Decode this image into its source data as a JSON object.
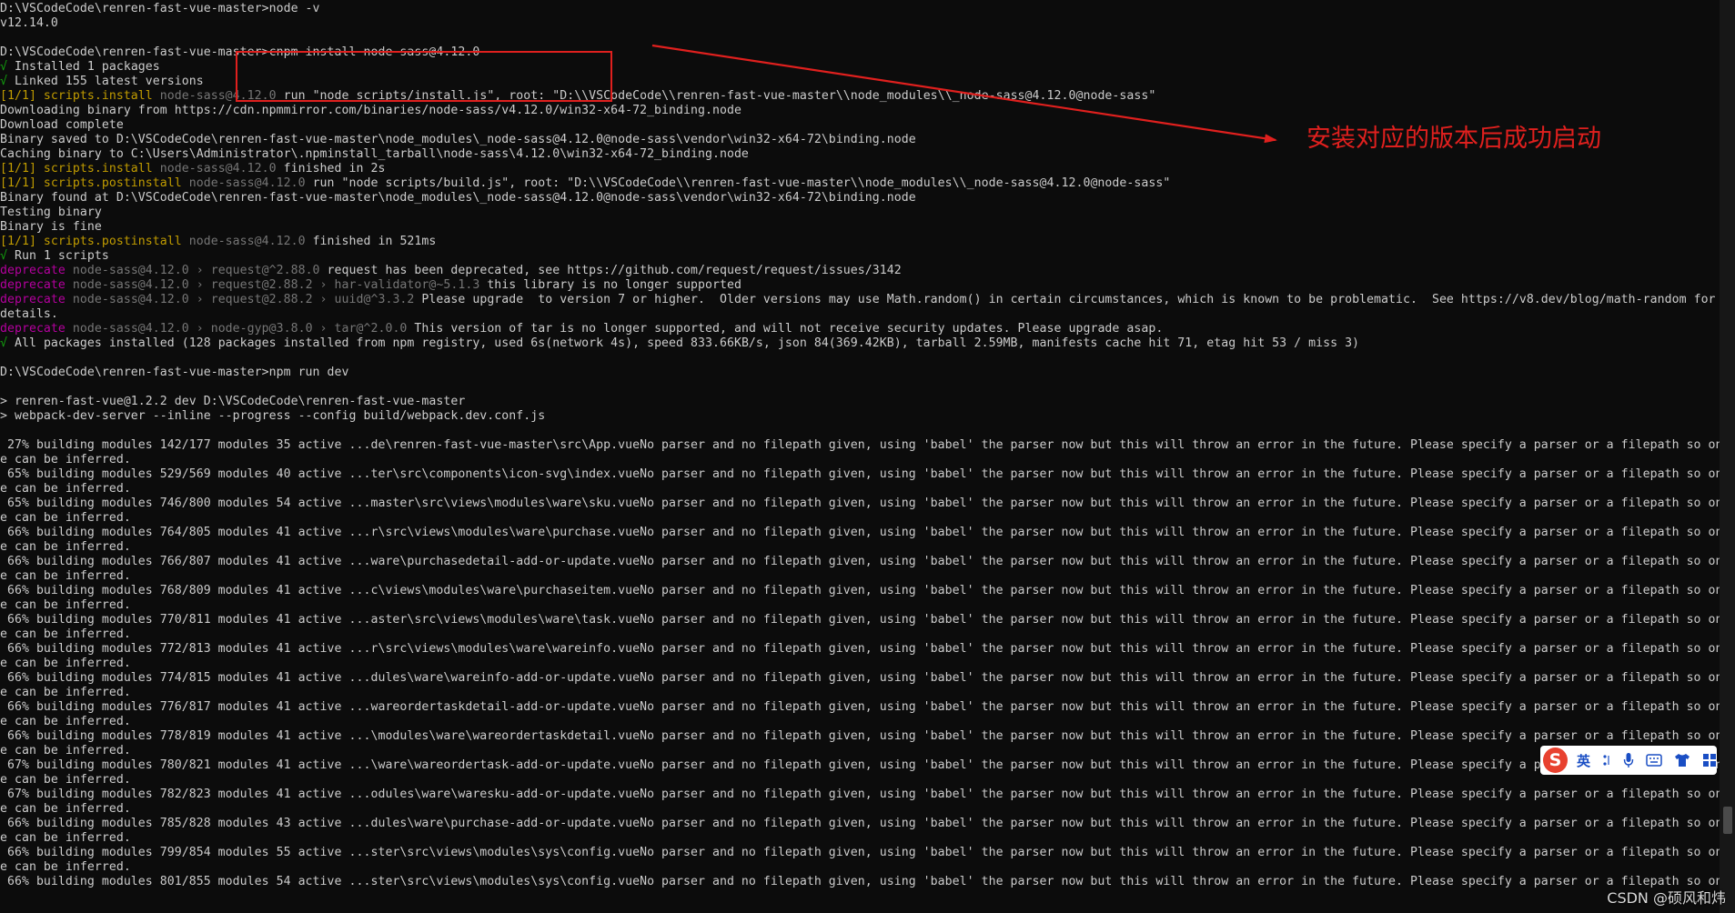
{
  "terminal": {
    "lines": [
      [
        {
          "t": "D:\\VSCodeCode\\renren-fast-vue-master>node -v",
          "c": "default"
        }
      ],
      [
        {
          "t": "v12.14.0",
          "c": "default"
        }
      ],
      [
        {
          "t": "",
          "c": "default"
        }
      ],
      [
        {
          "t": "D:\\VSCodeCode\\renren-fast-vue-master>cnpm install node-sass@4.12.0",
          "c": "default"
        }
      ],
      [
        {
          "t": "√ ",
          "c": "green"
        },
        {
          "t": "Installed 1 packages",
          "c": "default"
        }
      ],
      [
        {
          "t": "√ ",
          "c": "green"
        },
        {
          "t": "Linked 155 latest versions",
          "c": "default"
        }
      ],
      [
        {
          "t": "[1/1] scripts.install ",
          "c": "yellow"
        },
        {
          "t": "node-sass@4.12.0",
          "c": "grey"
        },
        {
          "t": " run \"node scripts/install.js\", root: \"D:\\\\VSCodeCode\\\\renren-fast-vue-master\\\\node_modules\\\\_node-sass@4.12.0@node-sass\"",
          "c": "default"
        }
      ],
      [
        {
          "t": "Downloading binary from https://cdn.npmmirror.com/binaries/node-sass/v4.12.0/win32-x64-72_binding.node",
          "c": "default"
        }
      ],
      [
        {
          "t": "Download complete",
          "c": "default"
        }
      ],
      [
        {
          "t": "Binary saved to D:\\VSCodeCode\\renren-fast-vue-master\\node_modules\\_node-sass@4.12.0@node-sass\\vendor\\win32-x64-72\\binding.node",
          "c": "default"
        }
      ],
      [
        {
          "t": "Caching binary to C:\\Users\\Administrator\\.npminstall_tarball\\node-sass\\4.12.0\\win32-x64-72_binding.node",
          "c": "default"
        }
      ],
      [
        {
          "t": "[1/1] scripts.install ",
          "c": "yellow"
        },
        {
          "t": "node-sass@4.12.0",
          "c": "grey"
        },
        {
          "t": " finished in 2s",
          "c": "default"
        }
      ],
      [
        {
          "t": "[1/1] scripts.postinstall ",
          "c": "yellow"
        },
        {
          "t": "node-sass@4.12.0",
          "c": "grey"
        },
        {
          "t": " run \"node scripts/build.js\", root: \"D:\\\\VSCodeCode\\\\renren-fast-vue-master\\\\node_modules\\\\_node-sass@4.12.0@node-sass\"",
          "c": "default"
        }
      ],
      [
        {
          "t": "Binary found at D:\\VSCodeCode\\renren-fast-vue-master\\node_modules\\_node-sass@4.12.0@node-sass\\vendor\\win32-x64-72\\binding.node",
          "c": "default"
        }
      ],
      [
        {
          "t": "Testing binary",
          "c": "default"
        }
      ],
      [
        {
          "t": "Binary is fine",
          "c": "default"
        }
      ],
      [
        {
          "t": "[1/1] scripts.postinstall ",
          "c": "yellow"
        },
        {
          "t": "node-sass@4.12.0",
          "c": "grey"
        },
        {
          "t": " finished in 521ms",
          "c": "default"
        }
      ],
      [
        {
          "t": "√ ",
          "c": "green"
        },
        {
          "t": "Run 1 scripts",
          "c": "default"
        }
      ],
      [
        {
          "t": "deprecate ",
          "c": "magenta"
        },
        {
          "t": "node-sass@4.12.0 › request@^2.88.0",
          "c": "grey"
        },
        {
          "t": " request has been deprecated, see https://github.com/request/request/issues/3142",
          "c": "default"
        }
      ],
      [
        {
          "t": "deprecate ",
          "c": "magenta"
        },
        {
          "t": "node-sass@4.12.0 › request@2.88.2 › har-validator@~5.1.3",
          "c": "grey"
        },
        {
          "t": " this library is no longer supported",
          "c": "default"
        }
      ],
      [
        {
          "t": "deprecate ",
          "c": "magenta"
        },
        {
          "t": "node-sass@4.12.0 › request@2.88.2 › uuid@^3.3.2",
          "c": "grey"
        },
        {
          "t": " Please upgrade  to version 7 or higher.  Older versions may use Math.random() in certain circumstances, which is known to be problematic.  See https://v8.dev/blog/math-random for",
          "c": "default"
        }
      ],
      [
        {
          "t": "details.",
          "c": "default"
        }
      ],
      [
        {
          "t": "deprecate ",
          "c": "magenta"
        },
        {
          "t": "node-sass@4.12.0 › node-gyp@3.8.0 › tar@^2.0.0",
          "c": "grey"
        },
        {
          "t": " This version of tar is no longer supported, and will not receive security updates. Please upgrade asap.",
          "c": "default"
        }
      ],
      [
        {
          "t": "√ ",
          "c": "green"
        },
        {
          "t": "All packages installed (128 packages installed from npm registry, used 6s(network 4s), speed 833.66KB/s, json 84(369.42KB), tarball 2.59MB, manifests cache hit 71, etag hit 53 / miss 3)",
          "c": "default"
        }
      ],
      [
        {
          "t": "",
          "c": "default"
        }
      ],
      [
        {
          "t": "D:\\VSCodeCode\\renren-fast-vue-master>npm run dev",
          "c": "default"
        }
      ],
      [
        {
          "t": "",
          "c": "default"
        }
      ],
      [
        {
          "t": "> renren-fast-vue@1.2.2 dev D:\\VSCodeCode\\renren-fast-vue-master",
          "c": "default"
        }
      ],
      [
        {
          "t": "> webpack-dev-server --inline --progress --config build/webpack.dev.conf.js",
          "c": "default"
        }
      ],
      [
        {
          "t": "",
          "c": "default"
        }
      ],
      [
        {
          "t": " 27% building modules 142/177 modules 35 active ...de\\renren-fast-vue-master\\src\\App.vueNo parser and no filepath given, using 'babel' the parser now but this will throw an error in the future. Please specify a parser or a filepath so on",
          "c": "default"
        }
      ],
      [
        {
          "t": "e can be inferred.",
          "c": "default"
        }
      ],
      [
        {
          "t": " 65% building modules 529/569 modules 40 active ...ter\\src\\components\\icon-svg\\index.vueNo parser and no filepath given, using 'babel' the parser now but this will throw an error in the future. Please specify a parser or a filepath so on",
          "c": "default"
        }
      ],
      [
        {
          "t": "e can be inferred.",
          "c": "default"
        }
      ],
      [
        {
          "t": " 65% building modules 746/800 modules 54 active ...master\\src\\views\\modules\\ware\\sku.vueNo parser and no filepath given, using 'babel' the parser now but this will throw an error in the future. Please specify a parser or a filepath so on",
          "c": "default"
        }
      ],
      [
        {
          "t": "e can be inferred.",
          "c": "default"
        }
      ],
      [
        {
          "t": " 66% building modules 764/805 modules 41 active ...r\\src\\views\\modules\\ware\\purchase.vueNo parser and no filepath given, using 'babel' the parser now but this will throw an error in the future. Please specify a parser or a filepath so on",
          "c": "default"
        }
      ],
      [
        {
          "t": "e can be inferred.",
          "c": "default"
        }
      ],
      [
        {
          "t": " 66% building modules 766/807 modules 41 active ...ware\\purchasedetail-add-or-update.vueNo parser and no filepath given, using 'babel' the parser now but this will throw an error in the future. Please specify a parser or a filepath so on",
          "c": "default"
        }
      ],
      [
        {
          "t": "e can be inferred.",
          "c": "default"
        }
      ],
      [
        {
          "t": " 66% building modules 768/809 modules 41 active ...c\\views\\modules\\ware\\purchaseitem.vueNo parser and no filepath given, using 'babel' the parser now but this will throw an error in the future. Please specify a parser or a filepath so on",
          "c": "default"
        }
      ],
      [
        {
          "t": "e can be inferred.",
          "c": "default"
        }
      ],
      [
        {
          "t": " 66% building modules 770/811 modules 41 active ...aster\\src\\views\\modules\\ware\\task.vueNo parser and no filepath given, using 'babel' the parser now but this will throw an error in the future. Please specify a parser or a filepath so on",
          "c": "default"
        }
      ],
      [
        {
          "t": "e can be inferred.",
          "c": "default"
        }
      ],
      [
        {
          "t": " 66% building modules 772/813 modules 41 active ...r\\src\\views\\modules\\ware\\wareinfo.vueNo parser and no filepath given, using 'babel' the parser now but this will throw an error in the future. Please specify a parser or a filepath so on",
          "c": "default"
        }
      ],
      [
        {
          "t": "e can be inferred.",
          "c": "default"
        }
      ],
      [
        {
          "t": " 66% building modules 774/815 modules 41 active ...dules\\ware\\wareinfo-add-or-update.vueNo parser and no filepath given, using 'babel' the parser now but this will throw an error in the future. Please specify a parser or a filepath so on",
          "c": "default"
        }
      ],
      [
        {
          "t": "e can be inferred.",
          "c": "default"
        }
      ],
      [
        {
          "t": " 66% building modules 776/817 modules 41 active ...wareordertaskdetail-add-or-update.vueNo parser and no filepath given, using 'babel' the parser now but this will throw an error in the future. Please specify a parser or a filepath so on",
          "c": "default"
        }
      ],
      [
        {
          "t": "e can be inferred.",
          "c": "default"
        }
      ],
      [
        {
          "t": " 66% building modules 778/819 modules 41 active ...\\modules\\ware\\wareordertaskdetail.vueNo parser and no filepath given, using 'babel' the parser now but this will throw an error in the future. Please specify a parser or a filepath so on",
          "c": "default"
        }
      ],
      [
        {
          "t": "e can be inferred.",
          "c": "default"
        }
      ],
      [
        {
          "t": " 67% building modules 780/821 modules 41 active ...\\ware\\wareordertask-add-or-update.vueNo parser and no filepath given, using 'babel' the parser now but this will throw an error in the future. Please specify a parser or a filepath so on",
          "c": "default"
        }
      ],
      [
        {
          "t": "e can be inferred.",
          "c": "default"
        }
      ],
      [
        {
          "t": " 67% building modules 782/823 modules 41 active ...odules\\ware\\waresku-add-or-update.vueNo parser and no filepath given, using 'babel' the parser now but this will throw an error in the future. Please specify a parser or a filepath so on",
          "c": "default"
        }
      ],
      [
        {
          "t": "e can be inferred.",
          "c": "default"
        }
      ],
      [
        {
          "t": " 66% building modules 785/828 modules 43 active ...dules\\ware\\purchase-add-or-update.vueNo parser and no filepath given, using 'babel' the parser now but this will throw an error in the future. Please specify a parser or a filepath so on",
          "c": "default"
        }
      ],
      [
        {
          "t": "e can be inferred.",
          "c": "default"
        }
      ],
      [
        {
          "t": " 66% building modules 799/854 modules 55 active ...ster\\src\\views\\modules\\sys\\config.vueNo parser and no filepath given, using 'babel' the parser now but this will throw an error in the future. Please specify a parser or a filepath so on",
          "c": "default"
        }
      ],
      [
        {
          "t": "e can be inferred.",
          "c": "default"
        }
      ],
      [
        {
          "t": " 66% building modules 801/855 modules 54 active ...ster\\src\\views\\modules\\sys\\config.vueNo parser and no filepath given, using 'babel' the parser now but this will throw an error in the future. Please specify a parser or a filepath so on",
          "c": "default"
        }
      ]
    ]
  },
  "annotation": {
    "label": "安装对应的版本后成功启动",
    "color": "#e0201e"
  },
  "ime": {
    "logo": "S",
    "lang": "英",
    "icons": [
      "punctuation-icon",
      "microphone-icon",
      "keyboard-icon",
      "skin-shirt-icon",
      "toolbox-grid-icon"
    ]
  },
  "watermark": "CSDN @硕风和炜",
  "scrollbar": {
    "position_fraction": 0.97
  },
  "colors": {
    "background": "#0c0c0c",
    "default": "#cccccc",
    "green": "#13a10e",
    "yellow": "#c19c00",
    "grey": "#767676",
    "magenta": "#b4009e"
  }
}
